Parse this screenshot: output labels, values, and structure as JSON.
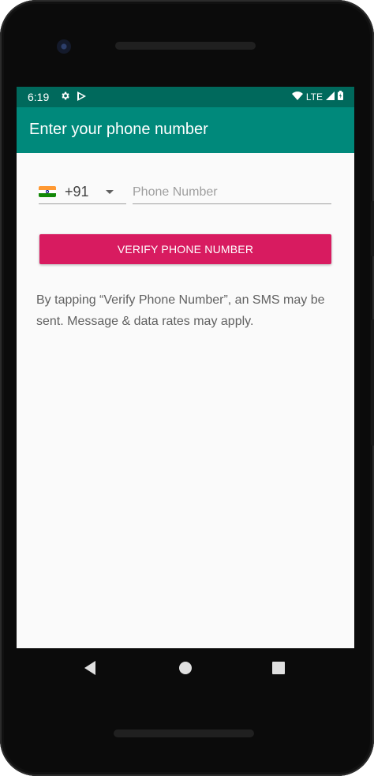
{
  "status_bar": {
    "time": "6:19",
    "network": "LTE",
    "icons": [
      "settings-gear-icon",
      "play-store-icon",
      "wifi-icon",
      "signal-icon",
      "battery-icon"
    ]
  },
  "app_bar": {
    "title": "Enter your phone number"
  },
  "form": {
    "country_flag": "india-flag-icon",
    "country_code": "+91",
    "phone_placeholder": "Phone Number",
    "phone_value": "",
    "verify_label": "VERIFY PHONE NUMBER"
  },
  "terms": {
    "text": "By tapping “Verify Phone Number”, an SMS may be sent. Message & data rates may apply."
  },
  "colors": {
    "status_bar": "#00695c",
    "app_bar": "#00897b",
    "accent_button": "#d81b60",
    "background": "#fafafa"
  }
}
